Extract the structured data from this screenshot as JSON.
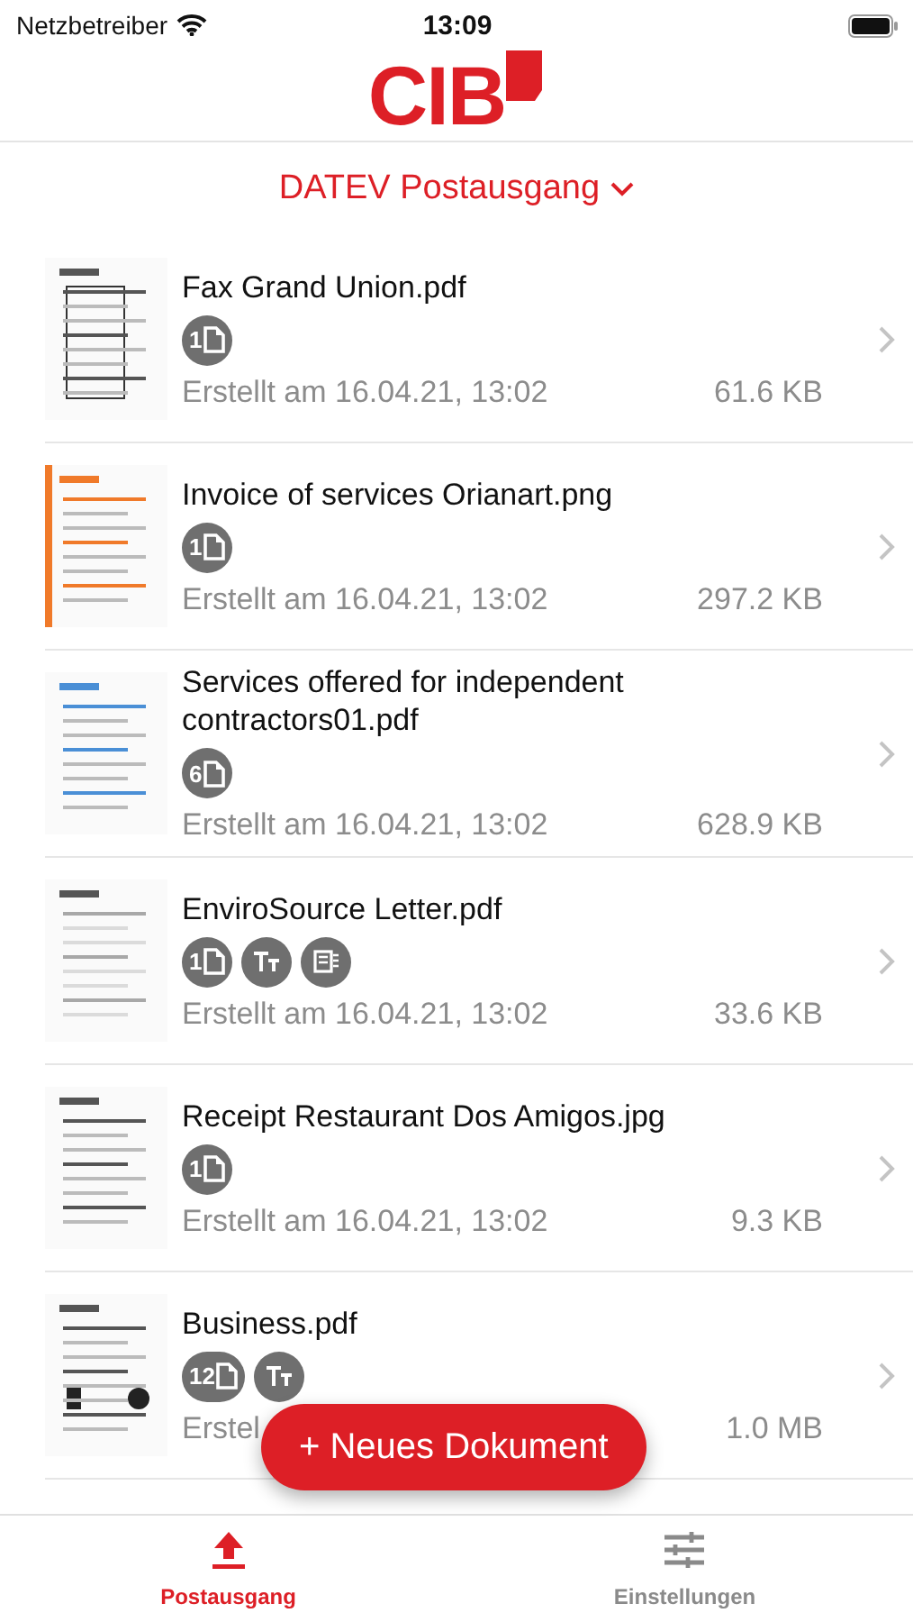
{
  "status_bar": {
    "carrier": "Netzbetreiber",
    "time": "13:09"
  },
  "header": {
    "logo": "CIB"
  },
  "folder": {
    "title": "DATEV Postausgang"
  },
  "documents": [
    {
      "name": "Fax Grand Union.pdf",
      "badges": [
        {
          "kind": "pages",
          "count": "1"
        }
      ],
      "created": "Erstellt am 16.04.21, 13:02",
      "size": "61.6 KB"
    },
    {
      "name": "Invoice of services Orianart.png",
      "badges": [
        {
          "kind": "pages",
          "count": "1"
        }
      ],
      "created": "Erstellt am 16.04.21, 13:02",
      "size": "297.2 KB"
    },
    {
      "name": "Services offered for independent contractors01.pdf",
      "badges": [
        {
          "kind": "pages",
          "count": "6"
        }
      ],
      "created": "Erstellt am 16.04.21, 13:02",
      "size": "628.9 KB"
    },
    {
      "name": "EnviroSource Letter.pdf",
      "badges": [
        {
          "kind": "pages",
          "count": "1"
        },
        {
          "kind": "text"
        },
        {
          "kind": "ocr"
        }
      ],
      "created": "Erstellt am 16.04.21, 13:02",
      "size": "33.6 KB"
    },
    {
      "name": "Receipt Restaurant Dos Amigos.jpg",
      "badges": [
        {
          "kind": "pages",
          "count": "1"
        }
      ],
      "created": "Erstellt am 16.04.21, 13:02",
      "size": "9.3 KB"
    },
    {
      "name": "Business.pdf",
      "badges": [
        {
          "kind": "pages",
          "count": "12"
        },
        {
          "kind": "text"
        }
      ],
      "created": "Erstel",
      "size": "1.0 MB"
    }
  ],
  "new_button": {
    "label": "+ Neues Dokument"
  },
  "tabs": [
    {
      "label": "Postausgang",
      "selected": true
    },
    {
      "label": "Einstellungen",
      "selected": false
    }
  ]
}
